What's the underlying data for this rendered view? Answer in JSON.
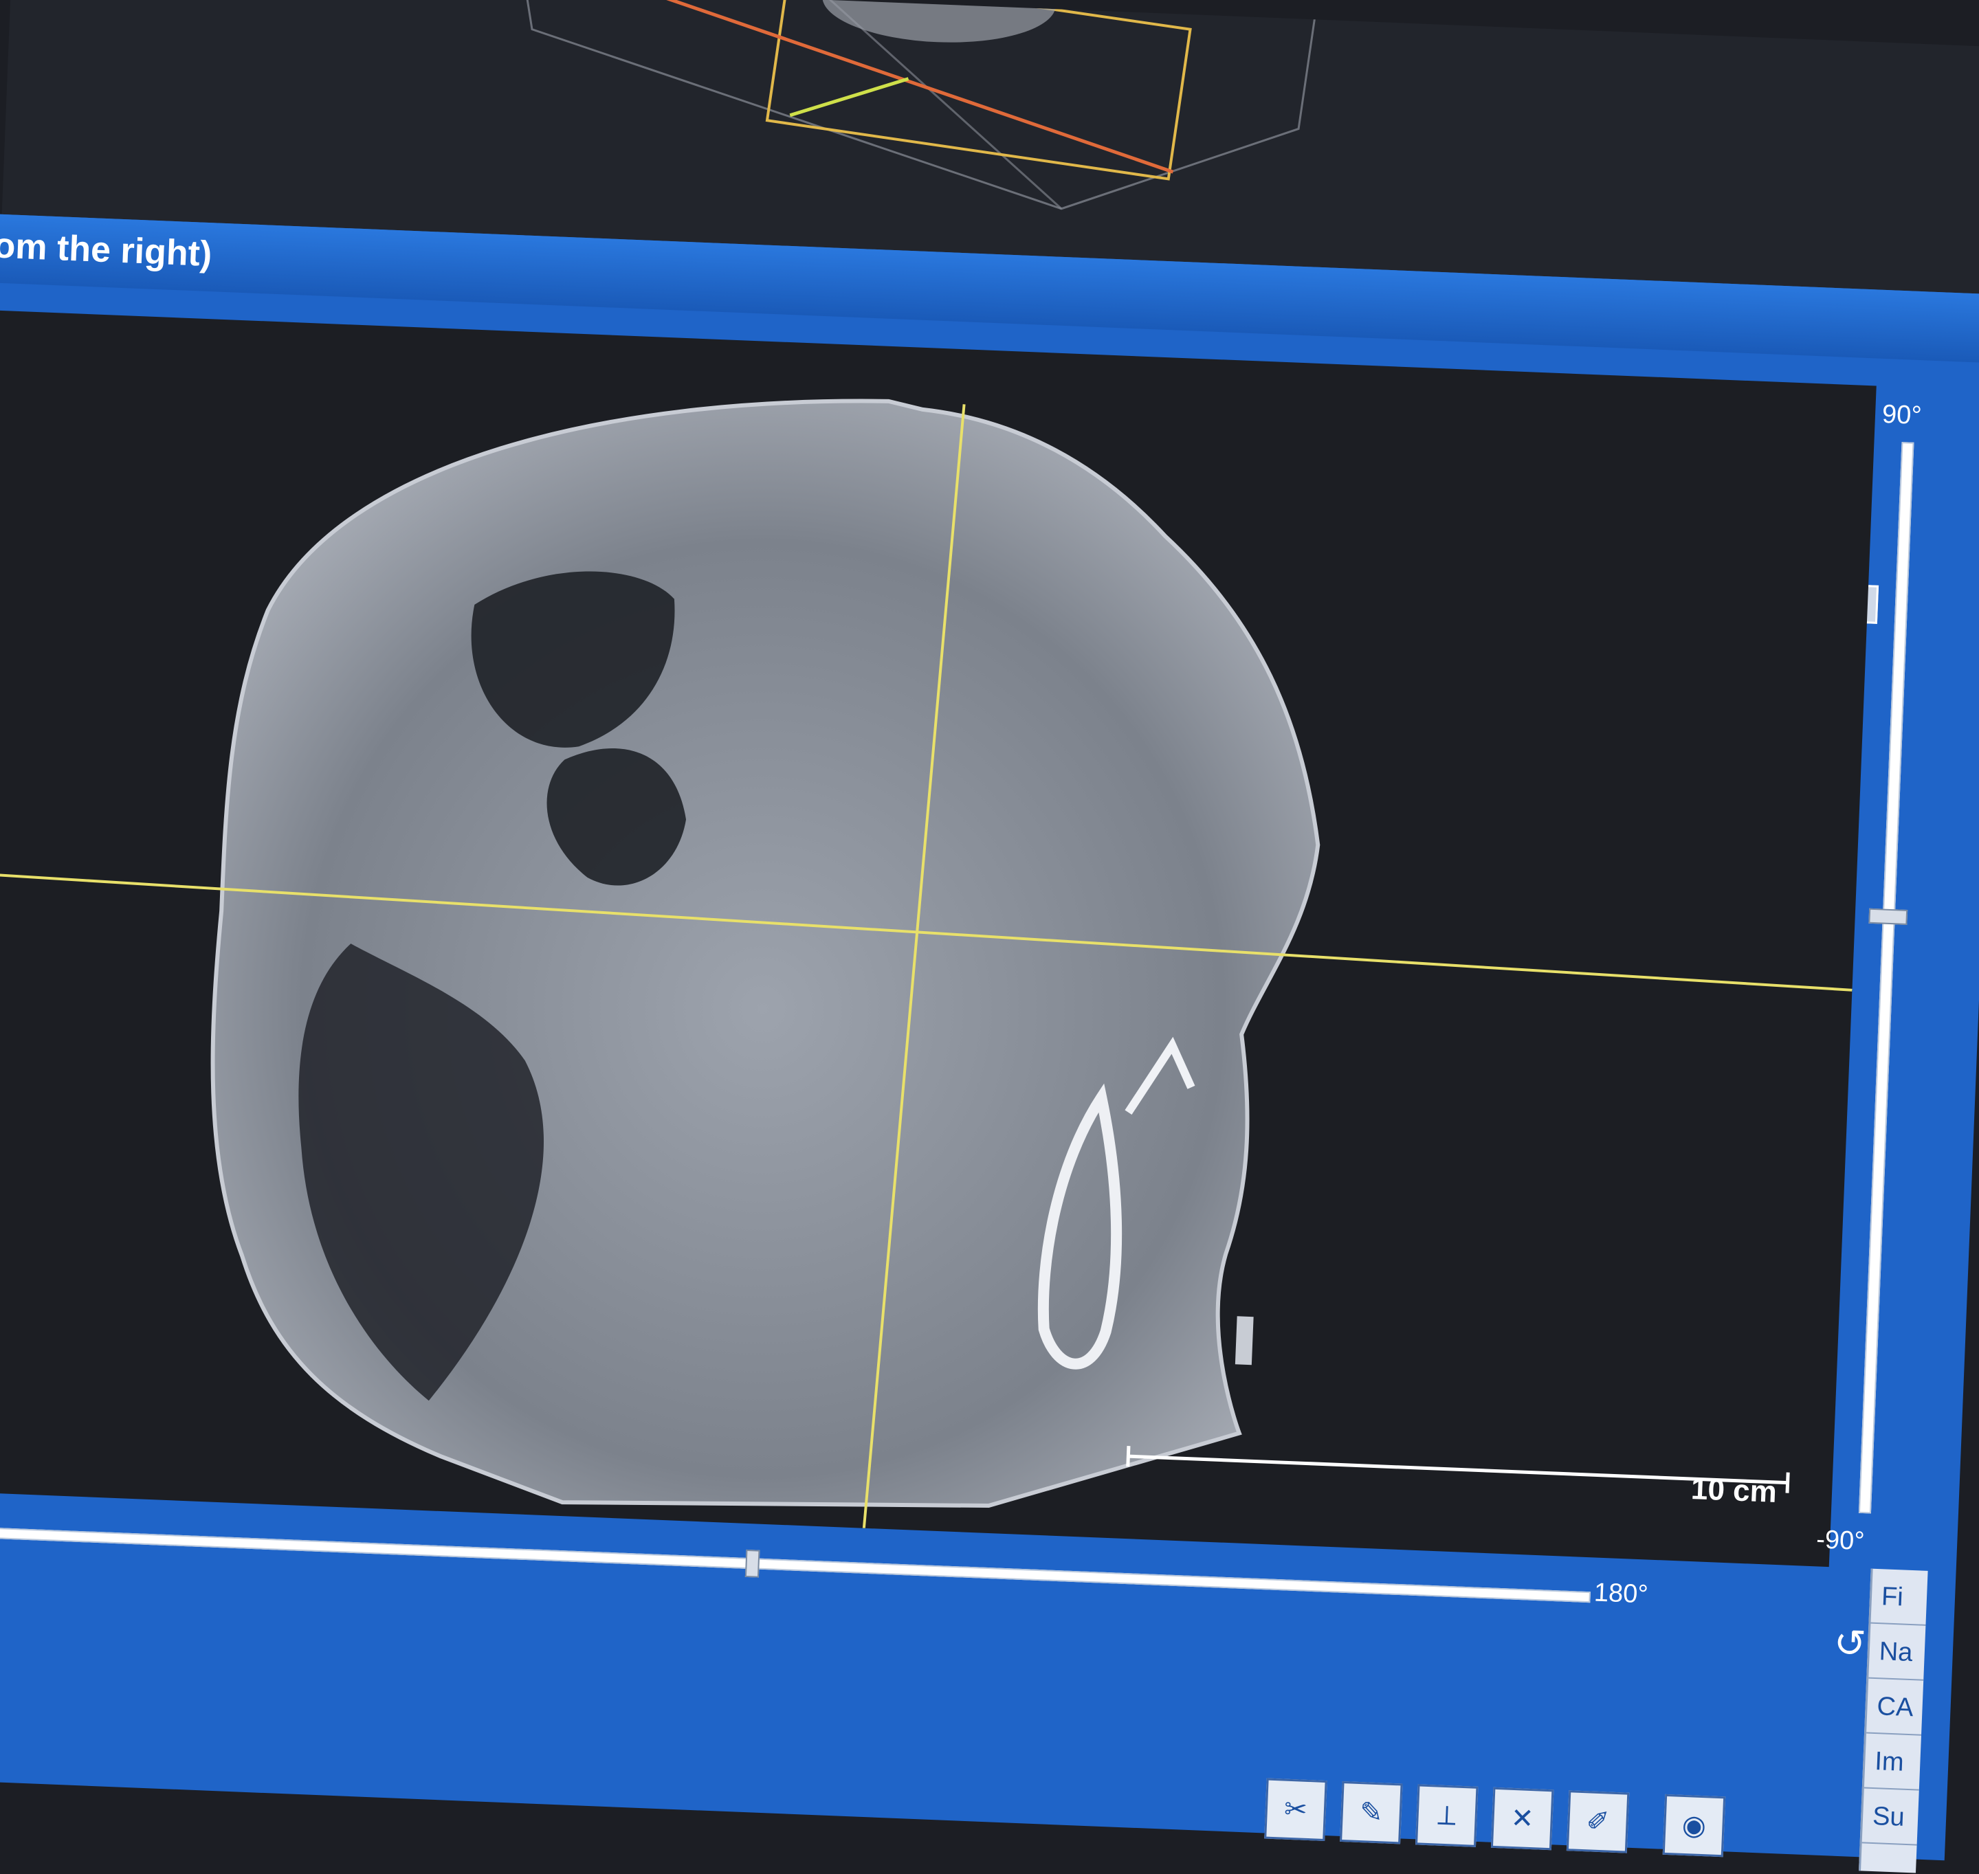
{
  "window": {
    "title": "om the right)"
  },
  "viewport": {
    "scale_bar_label": "10 cm"
  },
  "tilt_slider": {
    "top_label": "90°",
    "bottom_label": "-90°",
    "value_fraction": 0.5
  },
  "rotation_slider": {
    "end_label": "180°",
    "value_fraction": 0.5
  },
  "side_panel": {
    "items": [
      "Fi",
      "Na",
      "CA",
      "Im",
      "Su"
    ]
  },
  "toolbar": {
    "icons": [
      "cut-tool-icon",
      "trace-tool-icon",
      "measure-tool-icon",
      "erase-tool-icon",
      "draw-tool-icon",
      "view-tool-icon"
    ]
  },
  "colors": {
    "window_blue": "#1f64c8",
    "crosshair": "#e8e06a",
    "viewport_bg": "#1c1e23"
  }
}
